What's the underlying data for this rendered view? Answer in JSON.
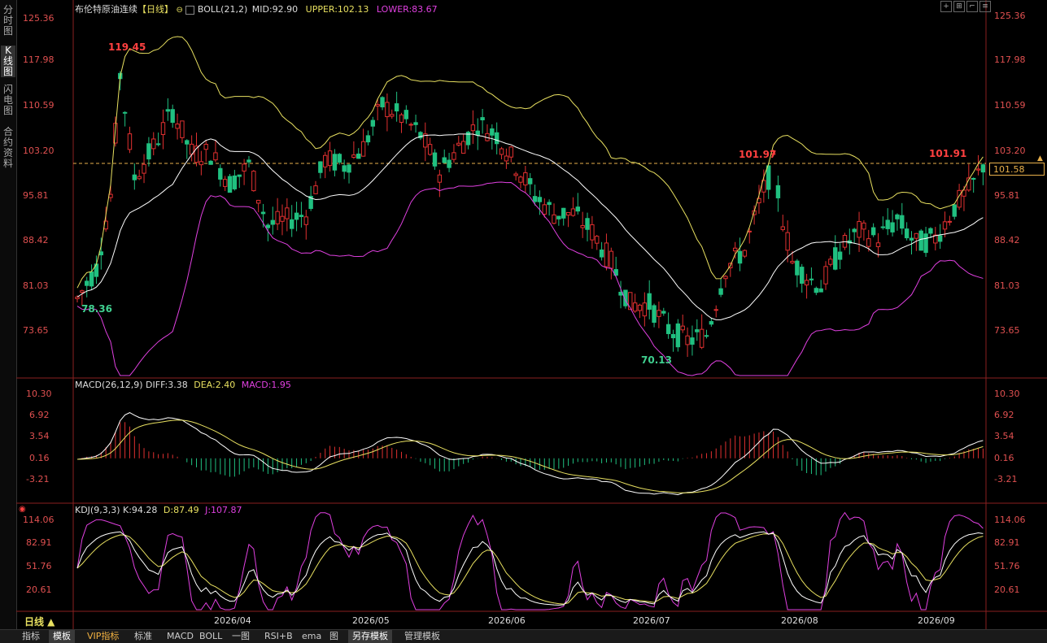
{
  "sidebar": {
    "tabs": [
      "分时图",
      "K线图",
      "闪电图",
      "合约资料"
    ],
    "active_index": 1
  },
  "main": {
    "symbol": "布伦特原油连续",
    "period": "【日线】",
    "indicator": "BOLL(21,2)",
    "mid": "MID:92.90",
    "upper": "UPPER:102.13",
    "lower": "LOWER:83.67",
    "y_ticks": [
      "125.36",
      "117.98",
      "110.59",
      "103.20",
      "95.81",
      "88.42",
      "81.03",
      "73.65"
    ],
    "current_price": "101.58",
    "peak_labels": [
      "119.45",
      "101.97",
      "101.91"
    ],
    "trough_labels": [
      "78.36",
      "70.13"
    ]
  },
  "macd": {
    "name": "MACD(26,12,9)",
    "diff": "DIFF:3.38",
    "dea": "DEA:2.40",
    "macd": "MACD:1.95",
    "y_ticks": [
      "10.30",
      "6.92",
      "3.54",
      "0.16",
      "-3.21"
    ]
  },
  "kdj": {
    "name": "KDJ(9,3,3)",
    "k": "K:94.28",
    "d": "D:87.49",
    "j": "J:107.87",
    "y_ticks": [
      "114.06",
      "82.91",
      "51.76",
      "20.61"
    ]
  },
  "x_axis": {
    "period_button": "日线 ▲",
    "months": [
      "2026/04",
      "2026/05",
      "2026/06",
      "2026/07",
      "2026/08",
      "2026/09"
    ]
  },
  "bottom_tabs": [
    "指标",
    "模板",
    "VIP指标",
    "标准",
    "MACD",
    "BOLL",
    "一图",
    "RSI+B",
    "ema",
    "图",
    "另存模板",
    "管理模板"
  ],
  "colors": {
    "up": "#e03030",
    "down": "#20c080",
    "mid": "#ffffff",
    "upper": "#e8e060",
    "lower": "#e040e0",
    "axis_text": "#e05050",
    "price_line": "#e8b04b"
  }
}
